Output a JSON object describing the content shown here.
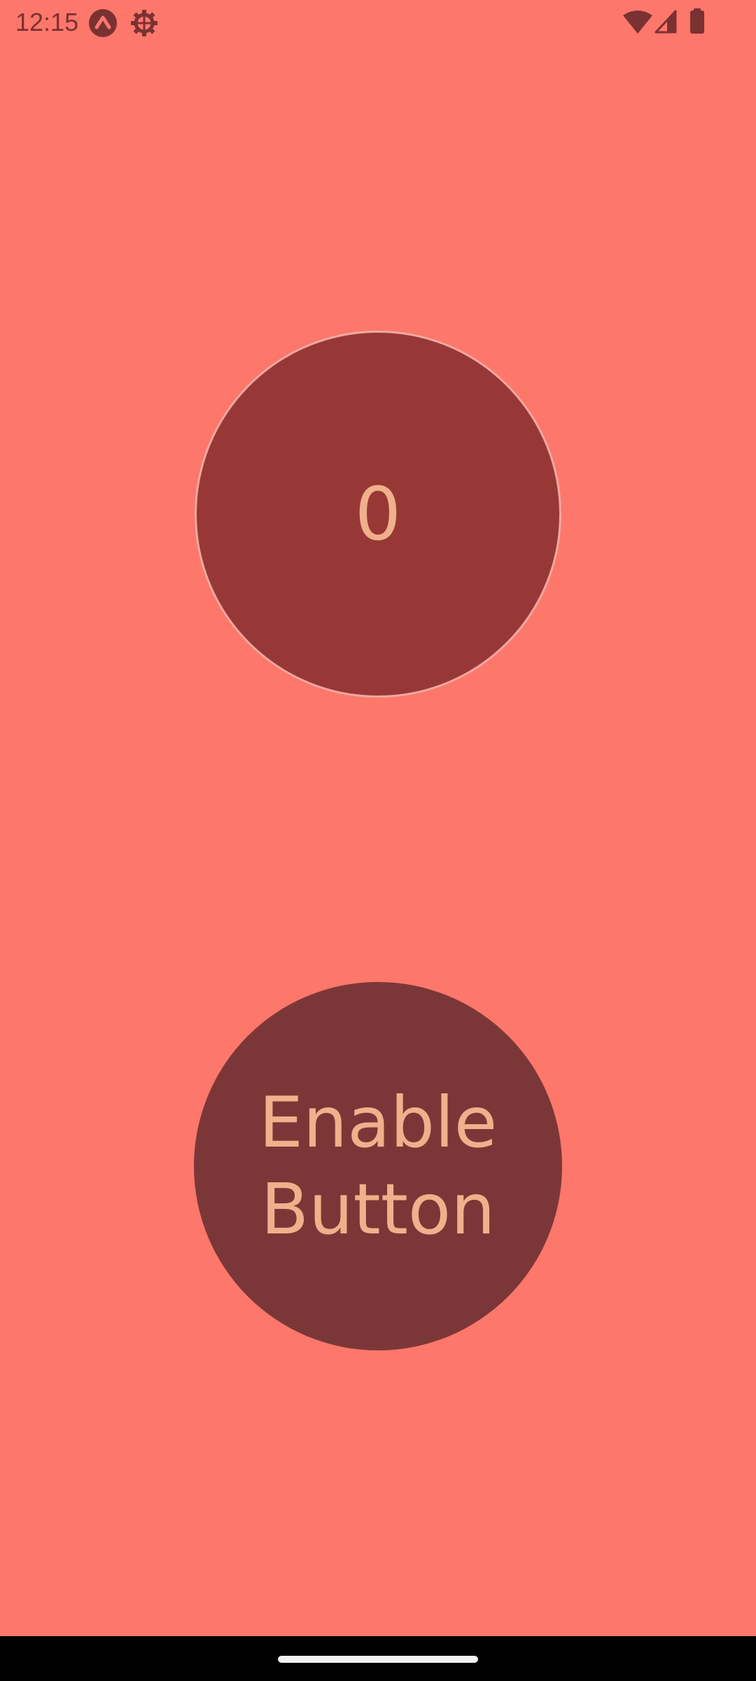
{
  "theme": {
    "background": "#fd776b",
    "status_fg": "#7a3131",
    "counter_fill": "#983836",
    "counter_border": "#f0a8a0",
    "text_accent": "#f0b08c",
    "button_fill": "#7b3737",
    "nav_bg": "#000000",
    "nav_handle": "#f2f2f2"
  },
  "status_bar": {
    "time": "12:15",
    "left_icons": [
      "app-notification-icon",
      "settings-gear-icon"
    ],
    "right_icons": [
      "wifi-icon",
      "cell-signal-icon",
      "battery-icon"
    ]
  },
  "counter": {
    "value": "0"
  },
  "enable_button": {
    "label": "Enable Button"
  },
  "navigation": {
    "handle": "gesture-nav-handle"
  }
}
